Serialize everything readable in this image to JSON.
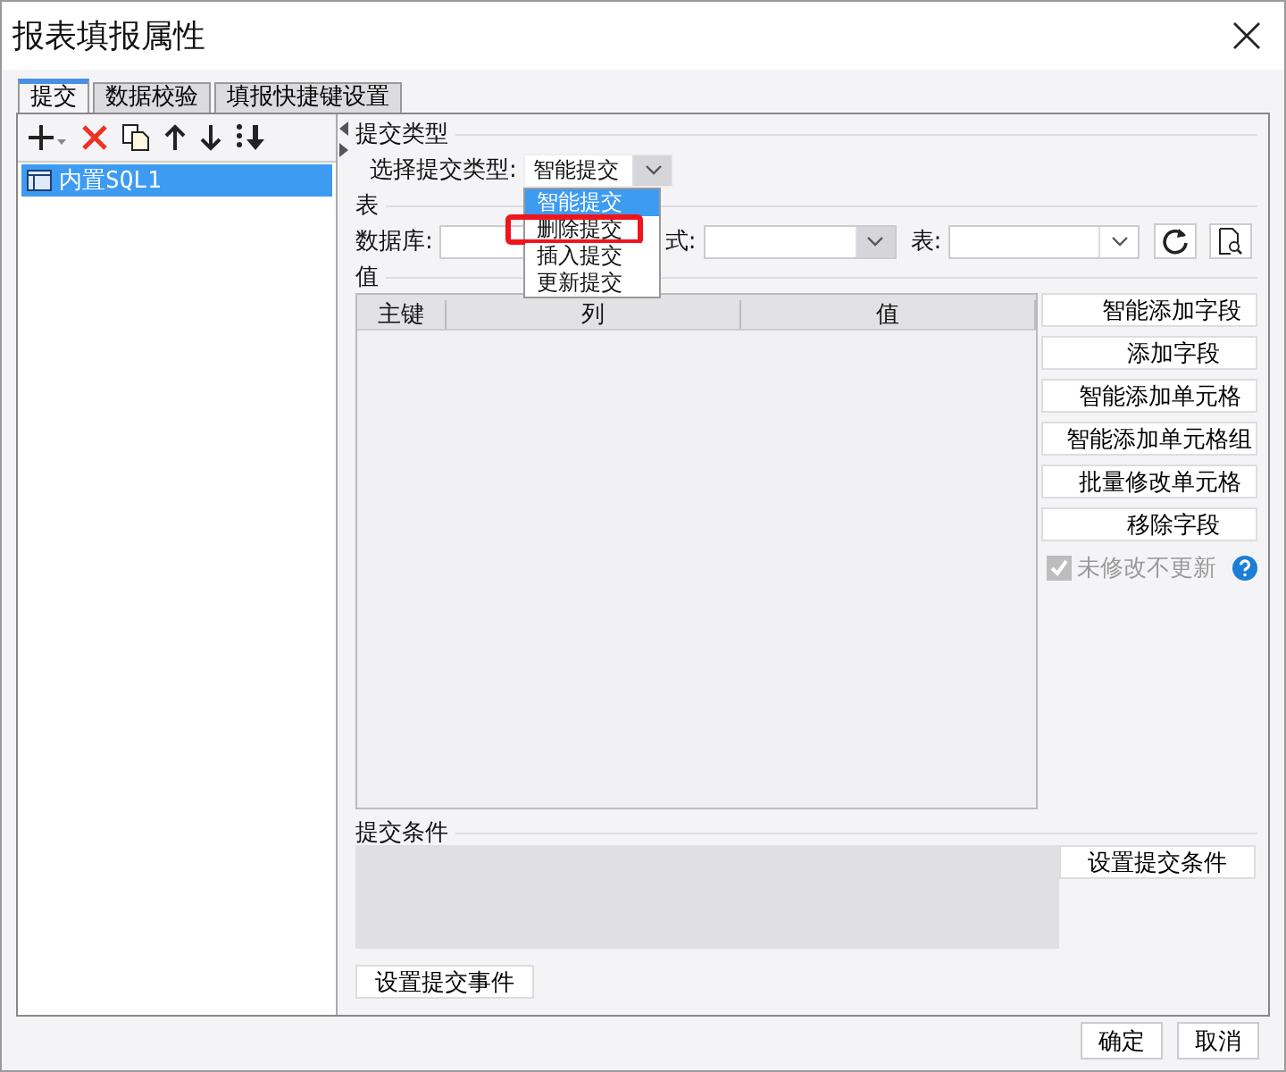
{
  "window": {
    "title": "报表填报属性"
  },
  "tabs": [
    {
      "label": "提交",
      "selected": true
    },
    {
      "label": "数据校验",
      "selected": false
    },
    {
      "label": "填报快捷键设置",
      "selected": false
    }
  ],
  "submit_list": [
    {
      "label": "内置SQL1",
      "selected": true
    }
  ],
  "submit_type": {
    "heading": "提交类型",
    "label": "选择提交类型:",
    "value": "智能提交",
    "open": true,
    "options": [
      {
        "label": "智能提交",
        "selected": true,
        "highlighted": false
      },
      {
        "label": "删除提交",
        "selected": false,
        "highlighted": true
      },
      {
        "label": "插入提交",
        "selected": false,
        "highlighted": false
      },
      {
        "label": "更新提交",
        "selected": false,
        "highlighted": false
      }
    ]
  },
  "table_section": {
    "heading": "表",
    "database_label": "数据库:",
    "schema_label": "式:",
    "table_label": "表:"
  },
  "values_section": {
    "heading": "值",
    "columns": [
      "主键",
      "列",
      "值"
    ],
    "buttons": [
      "智能添加字段",
      "添加字段",
      "智能添加单元格",
      "智能添加单元格组",
      "批量修改单元格",
      "移除字段"
    ],
    "option": {
      "label": "未修改不更新",
      "checked": true,
      "disabled": true
    }
  },
  "condition_section": {
    "heading": "提交条件",
    "button": "设置提交条件"
  },
  "event_button": "设置提交事件",
  "footer_buttons": [
    "确定",
    "取消"
  ]
}
